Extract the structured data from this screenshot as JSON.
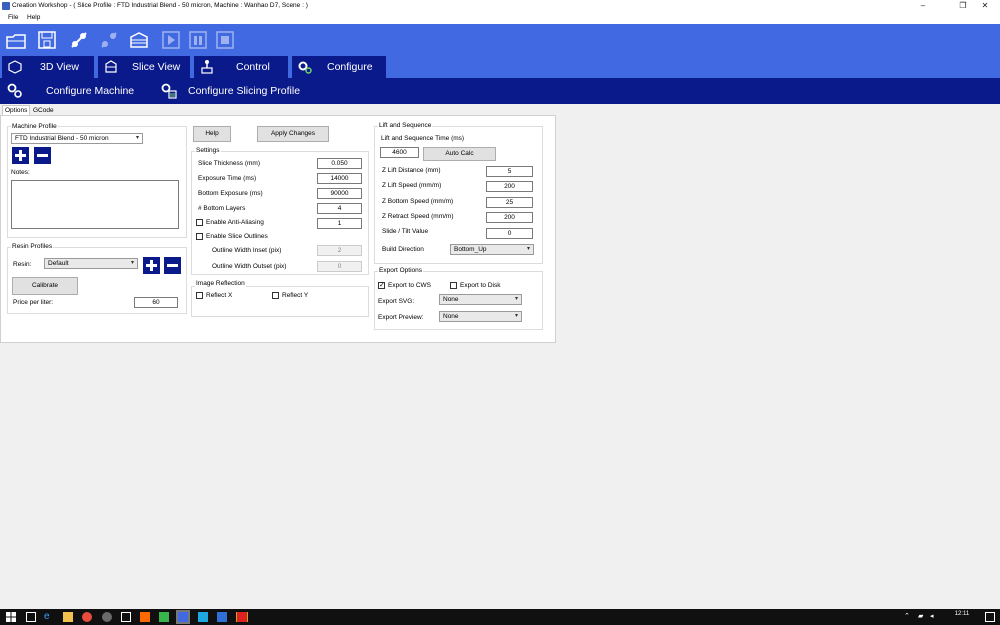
{
  "window": {
    "title": "Creation Workshop -   ( Slice Profile : FTD Industrial Blend - 50 micron, Machine : Wanhao D7, Scene : )",
    "min": "–",
    "max": "❐",
    "close": "✕"
  },
  "menu": {
    "file": "File",
    "help": "Help"
  },
  "toolbar_icons": [
    "open-icon",
    "save-icon",
    "connect-icon",
    "disconnect-icon",
    "slice-icon",
    "play-icon",
    "pause-icon",
    "stop-icon"
  ],
  "main_tabs": {
    "view3d": "3D View",
    "slice": "Slice View",
    "control": "Control",
    "configure": "Configure"
  },
  "config_tabs": {
    "machine": "Configure Machine",
    "slicing": "Configure Slicing Profile"
  },
  "sub_tabs": {
    "options": "Options",
    "gcode": "GCode"
  },
  "machine_profile": {
    "title": "Machine Profile",
    "selected": "FTD Industrial Blend - 50 micron",
    "notes_label": "Notes:"
  },
  "resin_profiles": {
    "title": "Resin Profiles",
    "resin_label": "Resin:",
    "resin_value": "Default",
    "calibrate": "Calibrate",
    "price_label": "Price per liter:",
    "price_value": "60"
  },
  "buttons": {
    "help": "Help",
    "apply": "Apply Changes"
  },
  "settings": {
    "title": "Settings",
    "slice_thickness_label": "Slice Thickness (mm)",
    "slice_thickness": "0.050",
    "exposure_label": "Exposure Time (ms)",
    "exposure": "14000",
    "bottom_exposure_label": "Bottom Exposure (ms)",
    "bottom_exposure": "90000",
    "bottom_layers_label": "# Bottom Layers",
    "bottom_layers": "4",
    "anti_alias_label": "Enable Anti-Aliasing",
    "anti_alias": "1",
    "outlines_label": "Enable Slice Outlines",
    "inset_label": "Outline Width Inset (pix)",
    "inset": "2",
    "outset_label": "Outline Width Outset (pix)",
    "outset": "0"
  },
  "reflection": {
    "title": "Image Reflection",
    "x": "Reflect X",
    "y": "Reflect Y"
  },
  "lift": {
    "title": "Lift and Sequence",
    "time_label": "Lift and Sequence Time (ms)",
    "time": "4600",
    "auto_calc": "Auto Calc",
    "z_dist_label": "Z Lift Distance (mm)",
    "z_dist": "5",
    "z_speed_label": "Z Lift Speed (mm/m)",
    "z_speed": "200",
    "z_bottom_label": "Z Bottom Speed (mm/m)",
    "z_bottom": "25",
    "z_retract_label": "Z Retract Speed (mm/m)",
    "z_retract": "200",
    "slide_label": "Slide / Tilt Value",
    "slide": "0",
    "direction_label": "Build Direction",
    "direction": "Bottom_Up"
  },
  "export": {
    "title": "Export Options",
    "cws": "Export to CWS",
    "disk": "Export to Disk",
    "svg_label": "Export SVG:",
    "svg": "None",
    "preview_label": "Export Preview:",
    "preview": "None"
  },
  "taskbar": {
    "time": "12:11"
  }
}
